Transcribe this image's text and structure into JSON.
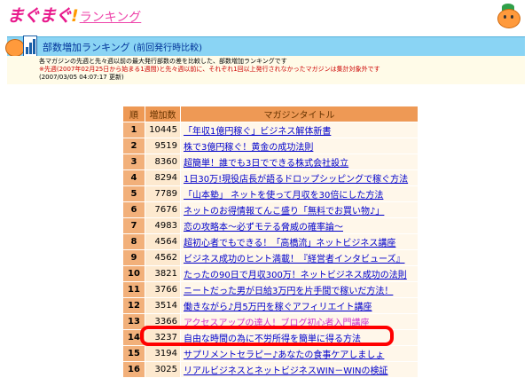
{
  "site": {
    "logo_main": "まぐまぐ",
    "logo_bang": "!",
    "logo_ranking": "ランキング"
  },
  "header": {
    "title": "部数増加ランキング",
    "subtitle": "(前回発行時比較)"
  },
  "notice": {
    "line1": "各マガジンの先週と先々週以前の最大発行部数の差を比較した、部数増加ランキングです",
    "line2": "※先週(2007年02月25日から始まる1週間)と先々週以前に、それぞれ1回以上発行されなかったマガジンは集計対象外です",
    "line3": "(2007/03/05 04:07:17 更新)"
  },
  "table": {
    "headers": {
      "rank": "順",
      "count": "増加数",
      "title": "マガジンタイトル"
    },
    "rows": [
      {
        "rank": "1",
        "count": "10445",
        "title": "「年収1億円稼ぐ」ビジネス解体新書"
      },
      {
        "rank": "2",
        "count": "9519",
        "title": "株で3億円稼ぐ！黄金の成功法則"
      },
      {
        "rank": "3",
        "count": "8360",
        "title": "超簡単！誰でも3日でできる株式会社設立"
      },
      {
        "rank": "4",
        "count": "8294",
        "title": "1日30万!現役店長が語るドロップシッピングで稼ぐ方法"
      },
      {
        "rank": "5",
        "count": "7789",
        "title": "「山本塾」 ネットを使って月収を30倍にした方法"
      },
      {
        "rank": "6",
        "count": "7676",
        "title": "ネットのお得情報てんこ盛り「無料でお買い物♪」"
      },
      {
        "rank": "7",
        "count": "4983",
        "title": "恋の攻略本～必ずモテる脅威の確率論～"
      },
      {
        "rank": "8",
        "count": "4564",
        "title": "超初心者でもできる！「高橋流」ネットビジネス講座"
      },
      {
        "rank": "9",
        "count": "4562",
        "title": "ビジネス成功のヒント満載！『経営者インタビューズ』"
      },
      {
        "rank": "10",
        "count": "3821",
        "title": "たったの90日で月収300万！ネットビジネス成功の法則"
      },
      {
        "rank": "11",
        "count": "3766",
        "title": "ニートだった男が日給3万円を片手間で稼いだ方法！"
      },
      {
        "rank": "12",
        "count": "3514",
        "title": "働きながら♪月5万円を稼ぐアフィリエイト講座"
      },
      {
        "rank": "13",
        "count": "3366",
        "title": "アクセスアップの達人！ブログ初心者入門講座"
      },
      {
        "rank": "14",
        "count": "3237",
        "title": "自由な時間の為に不労所得を簡単に得る方法"
      },
      {
        "rank": "15",
        "count": "3194",
        "title": "サプリメントセラピー♪あなたの食事ケアしましょ"
      },
      {
        "rank": "16",
        "count": "3025",
        "title": "リアルビジネスとネットビジネスWIN－WINの検証"
      }
    ]
  },
  "colors": {
    "header_band": "#8ad4f4",
    "table_header": "#ee9955",
    "rank_cell": "#f2b07a",
    "count_cell": "#fde9cf",
    "title_cell": "#fff7ea",
    "link": "#0000cc",
    "highlight": "#ff0000"
  },
  "highlighted_rank": "13"
}
